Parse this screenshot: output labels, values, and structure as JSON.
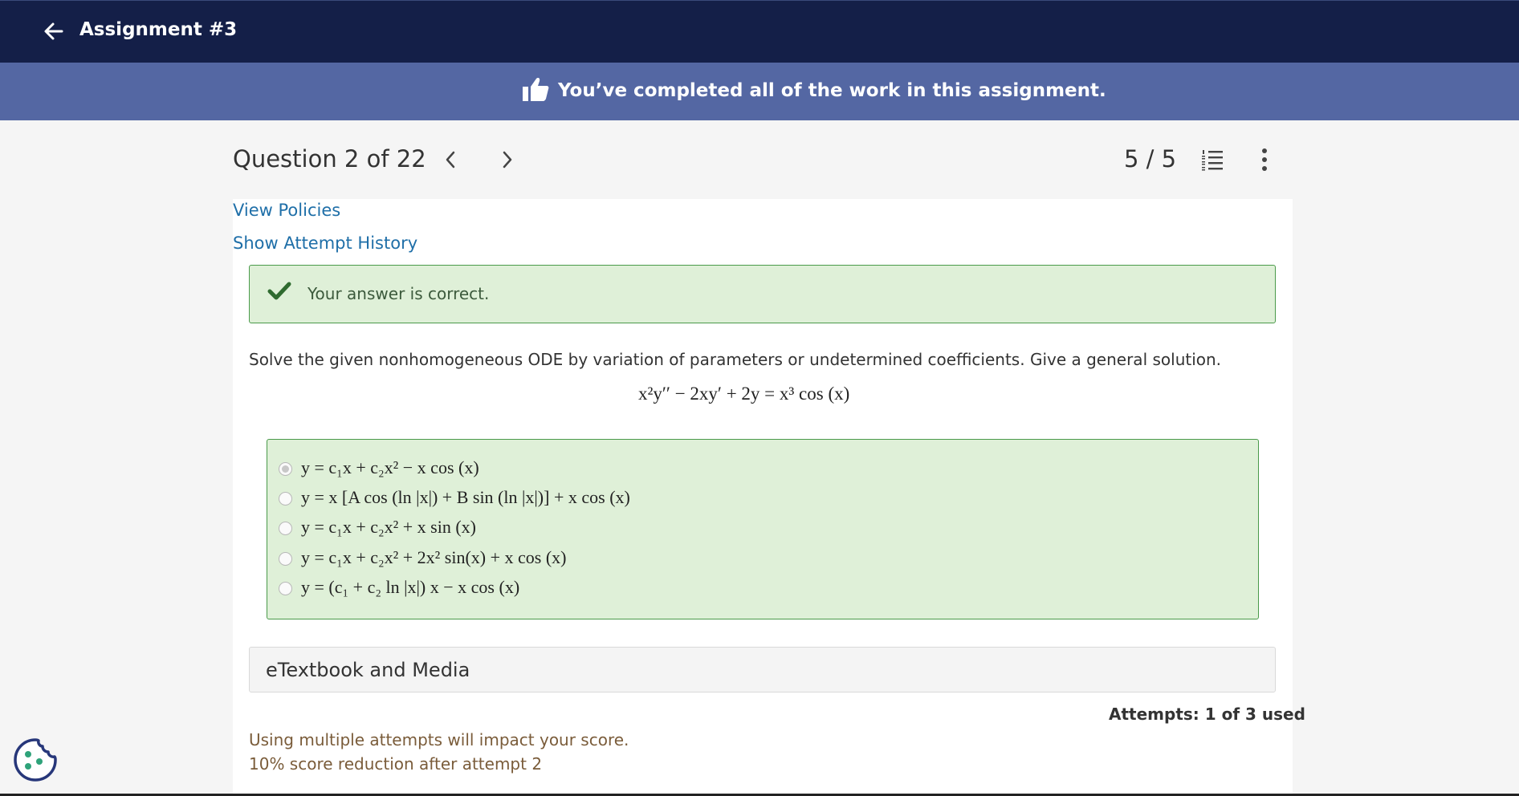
{
  "topbar": {
    "title": "Assignment #3",
    "back_icon": "arrow-left-icon"
  },
  "banner": {
    "text": "You’ve completed all of the work in this assignment.",
    "icon": "thumbs-up-icon"
  },
  "question_header": {
    "title": "Question 2 of 22",
    "prev_icon": "chevron-left-icon",
    "next_icon": "chevron-right-icon",
    "score": "5 / 5",
    "list_icon": "numbered-list-icon",
    "more_icon": "more-vertical-icon"
  },
  "links": {
    "view_policies": "View Policies",
    "attempt_history": "Show Attempt History"
  },
  "feedback": {
    "text": "Your answer is correct.",
    "icon": "checkmark-icon"
  },
  "question": {
    "prompt": "Solve the given nonhomogeneous ODE by variation of parameters or undetermined coefficients. Give a general solution.",
    "equation": "x²y′′ − 2xy′ + 2y = x³ cos (x)"
  },
  "choices": [
    {
      "text": "y = c₁x + c₂x² − x cos (x)",
      "selected": true
    },
    {
      "text": "y = x [A cos (ln |x|) + B sin (ln |x|)] + x cos (x)",
      "selected": false
    },
    {
      "text": "y = c₁x + c₂x² + x sin (x)",
      "selected": false
    },
    {
      "text": "y = c₁x + c₂x² + 2x² sin(x) + x cos (x)",
      "selected": false
    },
    {
      "text": "y = (c₁ + c₂ ln |x|) x − x cos (x)",
      "selected": false
    }
  ],
  "etextbook": {
    "label": "eTextbook and Media"
  },
  "attempts": {
    "text": "Attempts: 1 of 3 used"
  },
  "policy": {
    "line1": "Using multiple attempts will impact your score.",
    "line2": "10% score reduction after attempt 2"
  },
  "cookie_icon": "cookie-settings-icon",
  "colors": {
    "topbar": "#141f48",
    "banner": "#5467a3",
    "link": "#1f6fa8",
    "success_bg": "#dff0d8",
    "success_border": "#4a9a4a"
  }
}
